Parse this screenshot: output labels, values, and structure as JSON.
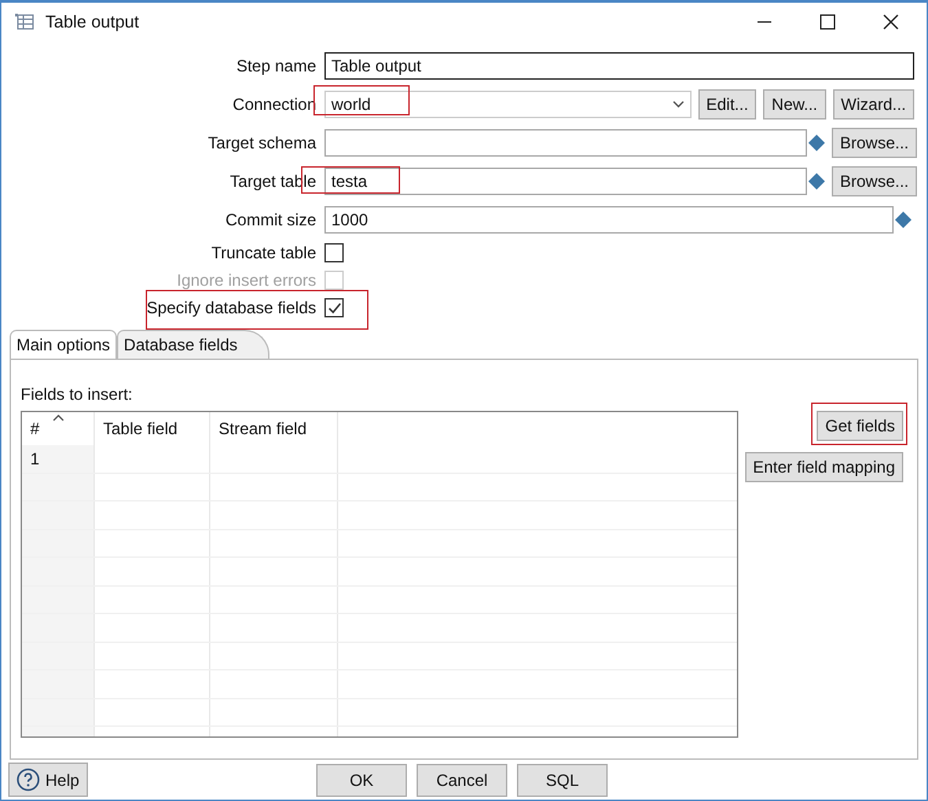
{
  "window": {
    "title": "Table output"
  },
  "fields": [
    {
      "kind": "text",
      "label": "Step name",
      "value": "Table output",
      "highlighted": false
    },
    {
      "kind": "combo",
      "label": "Connection",
      "value": "world",
      "highlighted": true,
      "buttons": [
        "Edit...",
        "New...",
        "Wizard..."
      ]
    },
    {
      "kind": "variable",
      "label": "Target schema",
      "highlighted": false,
      "buttons": [
        "Browse..."
      ]
    },
    {
      "kind": "variable",
      "label": "Target table",
      "value": "testa",
      "highlighted": true,
      "buttons": [
        "Browse..."
      ]
    },
    {
      "kind": "variable-wide",
      "label": "Commit size",
      "value": "1000",
      "highlighted": false
    },
    {
      "kind": "checkbox",
      "label": "Truncate table",
      "checked": false,
      "disabled": false,
      "highlighted": false
    },
    {
      "kind": "checkbox",
      "label": "Ignore insert errors",
      "checked": false,
      "disabled": true,
      "highlighted": false
    },
    {
      "kind": "checkbox",
      "label": "Specify database fields",
      "checked": true,
      "disabled": false,
      "highlighted": true
    }
  ],
  "tabs": [
    {
      "label": "Main options",
      "selected": false
    },
    {
      "label": "Database fields",
      "selected": true
    }
  ],
  "fields_to_insert": {
    "label": "Fields to insert:",
    "columns": [
      "#",
      "Table field",
      "Stream field"
    ],
    "rows": [
      {
        "number": "1"
      }
    ]
  },
  "side_buttons": [
    {
      "label": "Get fields",
      "highlighted": true
    },
    {
      "label": "Enter field mapping",
      "highlighted": false
    }
  ],
  "footer": {
    "help": "Help",
    "buttons": [
      "OK",
      "Cancel",
      "SQL"
    ]
  }
}
